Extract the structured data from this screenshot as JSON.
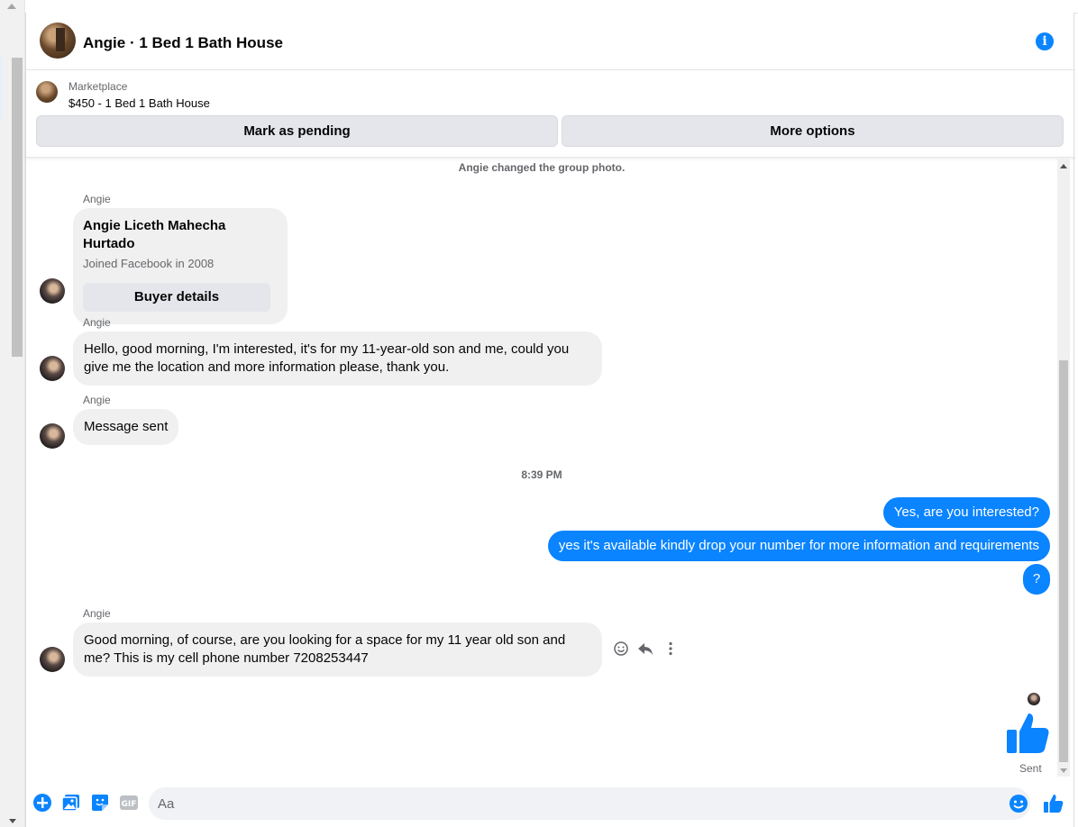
{
  "header": {
    "title": "Angie · 1 Bed 1 Bath House",
    "info_icon": "info-icon"
  },
  "marketplace": {
    "label": "Marketplace",
    "listing": "$450 - 1 Bed 1 Bath House",
    "mark_pending_label": "Mark as pending",
    "more_options_label": "More options"
  },
  "messages": {
    "system_note": "Angie changed the group photo.",
    "buyer_card": {
      "sender": "Angie",
      "name": "Angie Liceth Mahecha Hurtado",
      "joined": "Joined Facebook in 2008",
      "button_label": "Buyer details"
    },
    "incoming_1": {
      "sender": "Angie",
      "text": "Hello, good morning, I'm interested, it's for my 11-year-old son and me, could you give me the location and more information please, thank you."
    },
    "incoming_2": {
      "sender": "Angie",
      "text": "Message sent"
    },
    "timestamp": "8:39 PM",
    "outgoing": [
      "Yes, are you interested?",
      "yes it's available kindly drop your number for more information and requirements",
      "?"
    ],
    "incoming_3": {
      "sender": "Angie",
      "text": "Good morning, of course, are you looking for a space for my 11 year old son and me? This is my cell phone number 7208253447"
    },
    "status": "Sent"
  },
  "composer": {
    "placeholder": "Aa",
    "icons": [
      "add-circle-icon",
      "photo-icon",
      "sticker-icon",
      "gif-icon",
      "emoji-icon",
      "thumbs-up-icon"
    ],
    "gif_text": "GIF"
  },
  "colors": {
    "accent": "#0a84ff",
    "bubble_in": "#f0f0f0",
    "button_grey": "#e4e6eb"
  }
}
